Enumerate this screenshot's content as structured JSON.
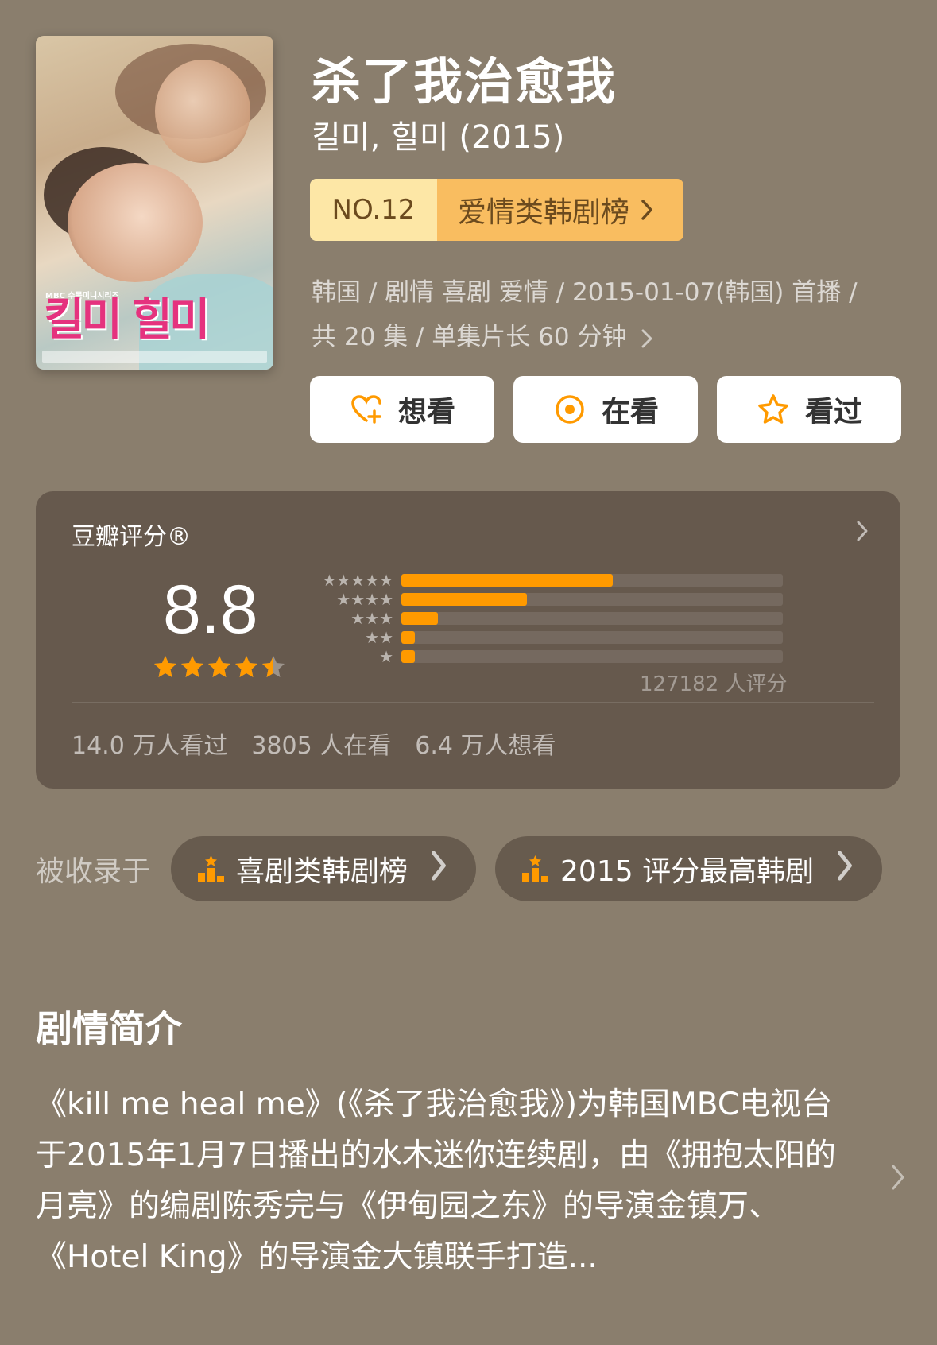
{
  "show": {
    "title": "杀了我治愈我",
    "original_title": "킬미, 힐미 (2015)",
    "rank_no": "NO.12",
    "rank_list": "爱情类韩剧榜",
    "meta_line1": "韩国 / 剧情 喜剧 爱情 / 2015-01-07(韩国) 首播 /",
    "meta_line2": "共 20 集 / 单集片长 60 分钟",
    "poster_text": "킬미 힐미",
    "poster_mbc": "MBC 수목미니시리즈"
  },
  "actions": {
    "want": "想看",
    "watching": "在看",
    "watched": "看过"
  },
  "rating": {
    "label": "豆瓣评分®",
    "score": "8.8",
    "stars": 4.5,
    "count_text": "127182 人评分",
    "distribution": [
      {
        "stars": 5,
        "fraction": 0.555
      },
      {
        "stars": 4,
        "fraction": 0.33
      },
      {
        "stars": 3,
        "fraction": 0.095
      },
      {
        "stars": 2,
        "fraction": 0.035
      },
      {
        "stars": 1,
        "fraction": 0.035
      }
    ],
    "stats": {
      "watched": "14.0 万人看过",
      "watching": "3805 人在看",
      "want": "6.4 万人想看"
    }
  },
  "collected": {
    "label": "被收录于",
    "lists": [
      "喜剧类韩剧榜",
      "2015 评分最高韩剧"
    ]
  },
  "synopsis": {
    "title": "剧情简介",
    "text": "《kill me heal me》(《杀了我治愈我》)为韩国MBC电视台于2015年1月7日播出的水木迷你连续剧，由《拥抱太阳的月亮》的编剧陈秀完与《伊甸园之东》的导演金镇万、《Hotel King》的导演金大镇联手打造..."
  },
  "colors": {
    "background": "#8a7e6d",
    "card": "#66594d",
    "accent": "#ff9a00"
  }
}
